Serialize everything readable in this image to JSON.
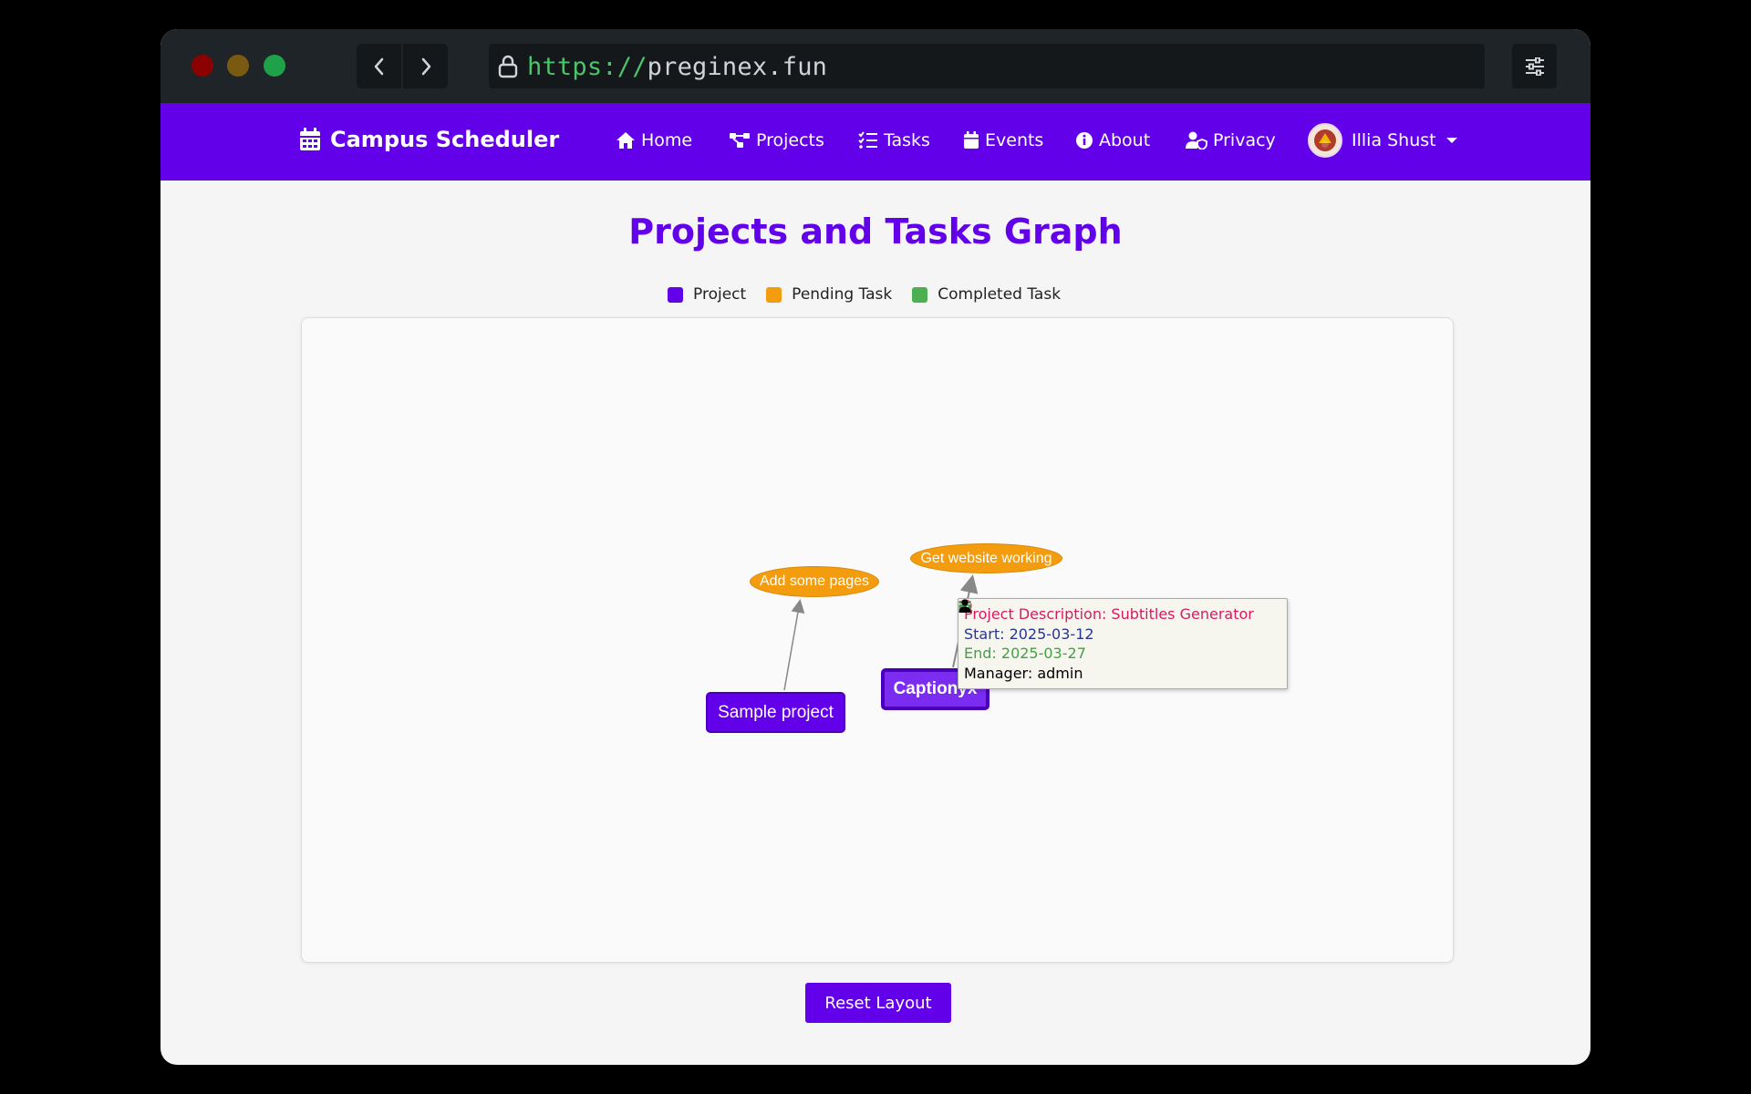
{
  "browser": {
    "url_scheme": "https://",
    "url_host": "preginex.fun"
  },
  "nav": {
    "brand": "Campus Scheduler",
    "links": [
      {
        "label": "Home",
        "icon": "home-icon"
      },
      {
        "label": "Projects",
        "icon": "project-diagram-icon"
      },
      {
        "label": "Tasks",
        "icon": "tasks-icon"
      },
      {
        "label": "Events",
        "icon": "calendar-icon"
      },
      {
        "label": "About",
        "icon": "info-icon"
      },
      {
        "label": "Privacy",
        "icon": "user-shield-icon"
      }
    ],
    "user": "Illia Shust"
  },
  "page": {
    "title": "Projects and Tasks Graph",
    "legend": [
      {
        "label": "Project",
        "color": "#6200ea"
      },
      {
        "label": "Pending Task",
        "color": "#f39c0e"
      },
      {
        "label": "Completed Task",
        "color": "#4caf50"
      }
    ],
    "reset_button": "Reset Layout"
  },
  "graph": {
    "nodes": {
      "sample_project": "Sample project",
      "captionyx": "Captionyx",
      "add_pages": "Add some pages",
      "website_working": "Get website working"
    },
    "tooltip": {
      "description": "Project Description: Subtitles Generator",
      "start": "Start: 2025-03-12",
      "end": "End: 2025-03-27",
      "manager": "Manager: admin",
      "colors": {
        "description": "#d81b60",
        "start": "#283593",
        "end": "#43a047",
        "manager": "#000000"
      }
    }
  }
}
